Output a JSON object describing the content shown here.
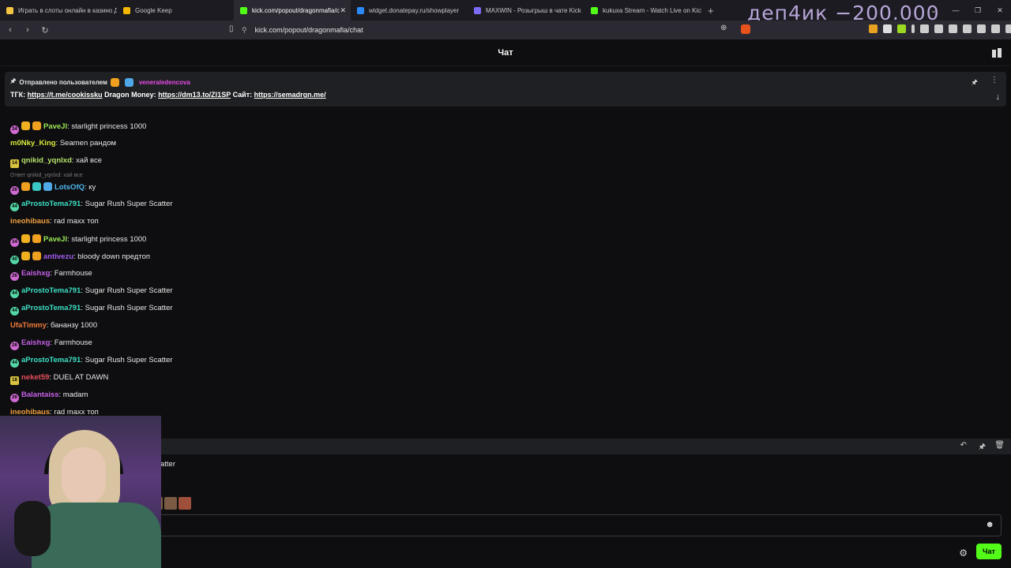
{
  "browser": {
    "tabs": [
      {
        "title": "Играть в слоты онлайн в казино Д",
        "active": false,
        "favicon_color": "#f5c542"
      },
      {
        "title": "Google Keep",
        "active": false,
        "favicon_color": "#f5b800"
      },
      {
        "title": "kick.com/popout/dragonmafia/c",
        "active": true,
        "favicon_color": "#53fc18"
      },
      {
        "title": "widget.donatepay.ru/showplayer",
        "active": false,
        "favicon_color": "#2b8af7"
      },
      {
        "title": "MAXWIN - Розыгрыш в чате Kick",
        "active": false,
        "favicon_color": "#7b6cf6"
      },
      {
        "title": "kukuxa Stream - Watch Live on Kick",
        "active": false,
        "favicon_color": "#53fc18"
      }
    ],
    "url": "kick.com/popout/dragonmafia/chat",
    "overlay_text": "деп4ик −200.000"
  },
  "chat": {
    "title": "Чат",
    "pinned": {
      "prefix": "Отправлено пользователем",
      "username": "veneraledencova",
      "text_parts": {
        "tg_label": "ТГК:",
        "tg_link": "https://t.me/cookissku",
        "dm_label": "Dragon Money:",
        "dm_link": "https://dm13.to/Zl1SP",
        "site_label": "Сайт:",
        "site_link": "https://semadrgn.me/"
      }
    },
    "reply_text": "Ответ qnikid_yqnlxd: хай все",
    "messages": [
      {
        "user": "PaveJl",
        "color": "#9be854",
        "text": ": starlight princess 1000",
        "badges": [
          "34",
          "K",
          "crown"
        ]
      },
      {
        "user": "m0Nky_King",
        "color": "#d9e83a",
        "text": ": Seamen рандом",
        "badges": []
      },
      {
        "user": "qnikid_yqnlxd",
        "color": "#b6e36b",
        "text": ": хай все",
        "badges": [
          "14"
        ]
      },
      {
        "user": "LotsOfQ",
        "color": "#4fb8f0",
        "text": ": ку",
        "badges": [
          "26",
          "crown",
          "vip",
          "dia"
        ]
      },
      {
        "user": "aProstoTema791",
        "color": "#3de0c5",
        "text": ": Sugar Rush Super Scatter",
        "badges": [
          "44"
        ]
      },
      {
        "user": "ineohibaus",
        "color": "#f0a040",
        "text": ": rad maxx топ",
        "badges": []
      },
      {
        "user": "PaveJl",
        "color": "#9be854",
        "text": ": starlight princess 1000",
        "badges": [
          "34",
          "K",
          "crown"
        ]
      },
      {
        "user": "antivezu",
        "color": "#a35cf0",
        "text": ": bloody down предтоп",
        "badges": [
          "40",
          "K",
          "crown"
        ]
      },
      {
        "user": "Eaishxg",
        "color": "#c760e8",
        "text": ": Farmhouse",
        "badges": [
          "26"
        ]
      },
      {
        "user": "aProstoTema791",
        "color": "#3de0c5",
        "text": ": Sugar Rush Super Scatter",
        "badges": [
          "44"
        ]
      },
      {
        "user": "aProstoTema791",
        "color": "#3de0c5",
        "text": ": Sugar Rush Super Scatter",
        "badges": [
          "44"
        ]
      },
      {
        "user": "UfaTimmy",
        "color": "#f07a3a",
        "text": ": бананзу 1000",
        "badges": []
      },
      {
        "user": "Eaishxg",
        "color": "#c760e8",
        "text": ": Farmhouse",
        "badges": [
          "26"
        ]
      },
      {
        "user": "aProstoTema791",
        "color": "#3de0c5",
        "text": ": Sugar Rush Super Scatter",
        "badges": [
          "44"
        ]
      },
      {
        "user": "neket59",
        "color": "#e8505c",
        "text": ": DUEL AT DAWN",
        "badges": [
          "18"
        ]
      },
      {
        "user": "Balantaiss",
        "color": "#c760e8",
        "text": ": madam",
        "badges": [
          "26"
        ]
      },
      {
        "user": "ineohibaus",
        "color": "#f0a040",
        "text": ": rad maxx топ",
        "badges": []
      }
    ],
    "partial_text": "atter",
    "send_label": "Чат"
  }
}
